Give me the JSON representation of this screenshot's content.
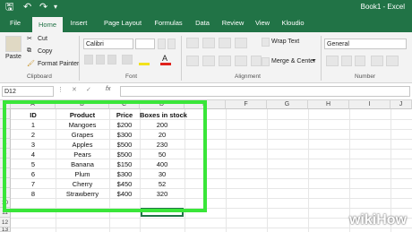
{
  "titlebar": {
    "title": "Book1 - Excel",
    "undo_icon": "undo-icon",
    "redo_icon": "redo-icon",
    "save_icon": "save-icon"
  },
  "tabs": [
    "File",
    "Home",
    "Insert",
    "Page Layout",
    "Formulas",
    "Data",
    "Review",
    "View",
    "Kloudio"
  ],
  "active_tab": "Home",
  "ribbon": {
    "clipboard": {
      "paste": "Paste",
      "cut": "Cut",
      "copy": "Copy",
      "format_painter": "Format Painter",
      "group": "Clipboard"
    },
    "font": {
      "name": "Calibri",
      "group": "Font"
    },
    "alignment": {
      "wrap_text": "Wrap Text",
      "merge_center": "Merge & Center",
      "group": "Alignment"
    },
    "number": {
      "format": "General",
      "group": "Number"
    }
  },
  "formula_bar": {
    "name_box": "D12",
    "fx": "fx"
  },
  "columns": [
    "A",
    "B",
    "C",
    "D",
    "E",
    "F",
    "G",
    "H",
    "I",
    "J"
  ],
  "rows": [
    "1",
    "2",
    "3",
    "4",
    "5",
    "6",
    "7",
    "8",
    "9",
    "10",
    "11",
    "12",
    "13"
  ],
  "table": {
    "headers": [
      "ID",
      "Product",
      "Price",
      "Boxes in stock"
    ],
    "rows": [
      [
        "1",
        "Mangoes",
        "$200",
        "200"
      ],
      [
        "2",
        "Grapes",
        "$300",
        "20"
      ],
      [
        "3",
        "Apples",
        "$500",
        "230"
      ],
      [
        "4",
        "Pears",
        "$500",
        "50"
      ],
      [
        "5",
        "Banana",
        "$150",
        "400"
      ],
      [
        "6",
        "Plum",
        "$300",
        "30"
      ],
      [
        "7",
        "Cherry",
        "$450",
        "52"
      ],
      [
        "8",
        "Strawberry",
        "$400",
        "320"
      ]
    ]
  },
  "watermark": "wikiHow",
  "colors": {
    "excel_green": "#217346",
    "highlight": "#39e639"
  }
}
